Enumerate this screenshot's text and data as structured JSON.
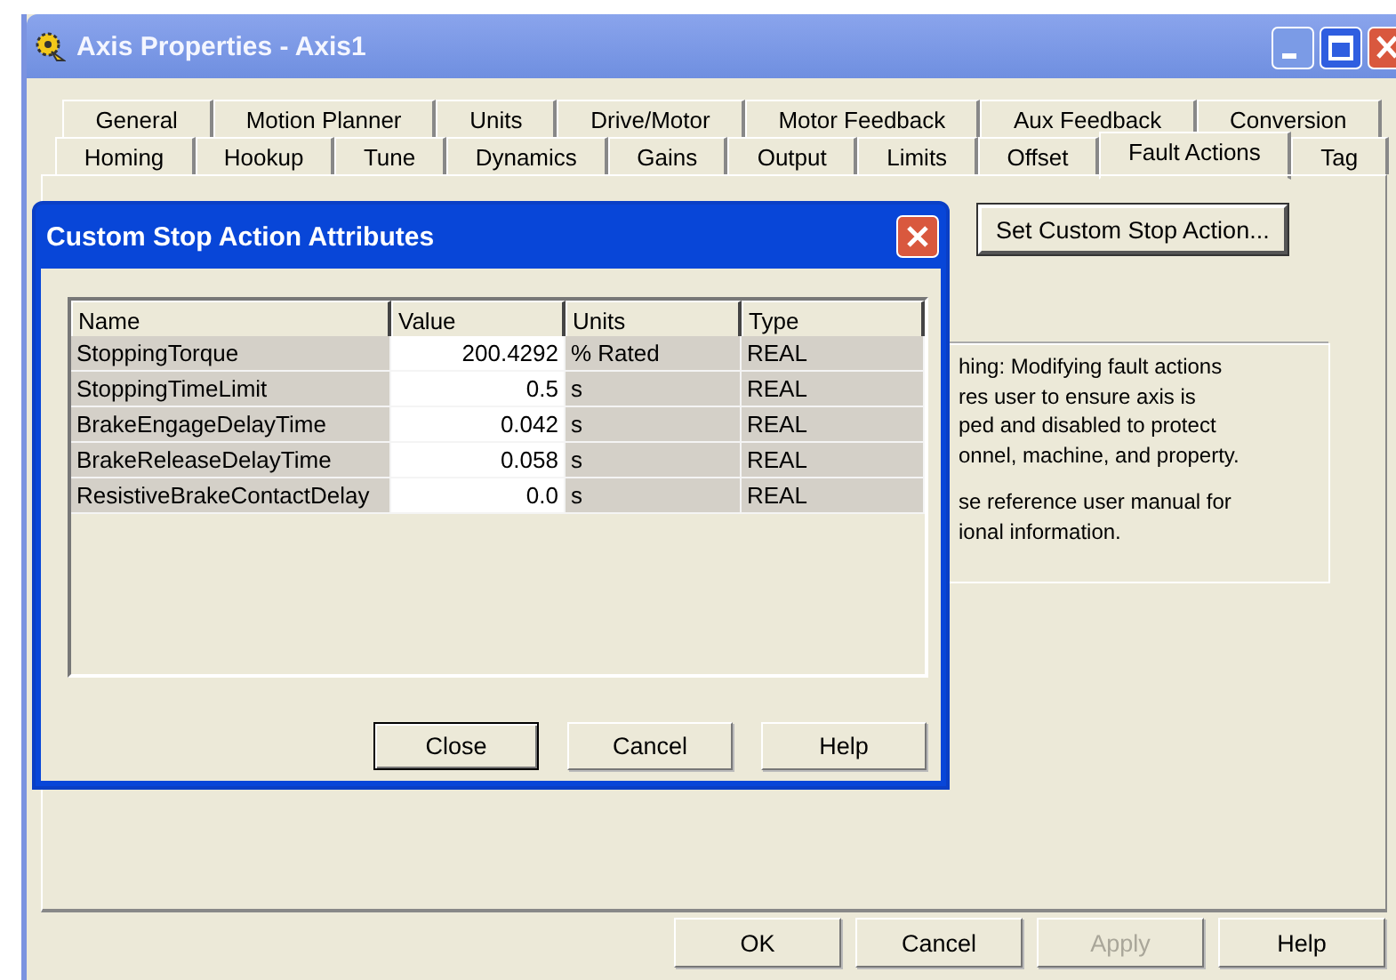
{
  "window": {
    "title": "Axis Properties - Axis1"
  },
  "tab_rows": [
    [
      {
        "label": "General",
        "selected": false
      },
      {
        "label": "Motion Planner",
        "selected": false
      },
      {
        "label": "Units",
        "selected": false
      },
      {
        "label": "Drive/Motor",
        "selected": false
      },
      {
        "label": "Motor Feedback",
        "selected": false
      },
      {
        "label": "Aux Feedback",
        "selected": false
      },
      {
        "label": "Conversion",
        "selected": false
      }
    ],
    [
      {
        "label": "Homing",
        "selected": false
      },
      {
        "label": "Hookup",
        "selected": false
      },
      {
        "label": "Tune",
        "selected": false
      },
      {
        "label": "Dynamics",
        "selected": false
      },
      {
        "label": "Gains",
        "selected": false
      },
      {
        "label": "Output",
        "selected": false
      },
      {
        "label": "Limits",
        "selected": false
      },
      {
        "label": "Offset",
        "selected": false
      },
      {
        "label": "Fault Actions",
        "selected": true
      },
      {
        "label": "Tag",
        "selected": false
      }
    ]
  ],
  "set_custom_stop_action_button": "Set Custom Stop Action...",
  "warning": {
    "paragraphs": [
      [
        "hing: Modifying fault actions",
        "res user to ensure axis is",
        "ped and disabled to protect",
        "onnel, machine, and property."
      ],
      [
        "se reference user manual for",
        "ional information."
      ]
    ]
  },
  "dialog": {
    "title": "Custom Stop Action Attributes",
    "columns": [
      "Name",
      "Value",
      "Units",
      "Type"
    ],
    "rows": [
      {
        "name": "StoppingTorque",
        "value": "200.4292",
        "units": "% Rated",
        "type": "REAL"
      },
      {
        "name": "StoppingTimeLimit",
        "value": "0.5",
        "units": "s",
        "type": "REAL"
      },
      {
        "name": "BrakeEngageDelayTime",
        "value": "0.042",
        "units": "s",
        "type": "REAL"
      },
      {
        "name": "BrakeReleaseDelayTime",
        "value": "0.058",
        "units": "s",
        "type": "REAL"
      },
      {
        "name": "ResistiveBrakeContactDelay",
        "value": "0.0",
        "units": "s",
        "type": "REAL"
      }
    ],
    "buttons": [
      {
        "label": "Close",
        "default": true
      },
      {
        "label": "Cancel",
        "default": false
      },
      {
        "label": "Help",
        "default": false
      }
    ]
  },
  "buttons": [
    {
      "label": "OK",
      "disabled": false
    },
    {
      "label": "Cancel",
      "disabled": false
    },
    {
      "label": "Apply",
      "disabled": true
    },
    {
      "label": "Help",
      "disabled": false
    }
  ]
}
